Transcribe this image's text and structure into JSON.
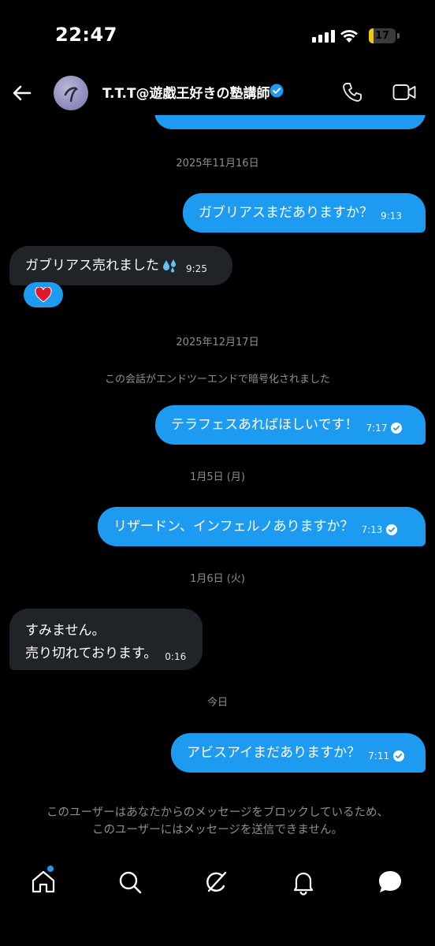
{
  "status_bar": {
    "time": "22:47",
    "battery": "17",
    "battery_level": 0.17
  },
  "header": {
    "contact_name": "T.T.T@遊戯王好きの塾講師",
    "verified": true
  },
  "colors": {
    "accent": "#1d9bf0",
    "incoming_bubble": "#202327",
    "muted_text": "#8b8f94",
    "background": "#000000"
  },
  "conversation": {
    "date_1": "2025年11月16日",
    "msg_1": {
      "text": "ガブリアスまだありますか？",
      "time": "9:13",
      "direction": "outgoing"
    },
    "msg_2": {
      "text": "ガブリアス売れました",
      "emoji_icon": "sweat-droplets-icon",
      "time": "9:25",
      "direction": "incoming",
      "reaction_icon": "red-heart-icon"
    },
    "date_2": "2025年12月17日",
    "system_notice": "この会話がエンドツーエンドで暗号化されました",
    "msg_3": {
      "text": "テラフェスあればほしいです！",
      "time": "7:17",
      "direction": "outgoing",
      "status_icon": "read-check-icon"
    },
    "date_3": "1月5日 (月)",
    "msg_4": {
      "text": "リザードン、インフェルノありますか？",
      "time": "7:13",
      "direction": "outgoing",
      "status_icon": "read-check-icon"
    },
    "date_4": "1月6日 (火)",
    "msg_5": {
      "line_1": "すみません。",
      "line_2": "売り切れております。",
      "time": "0:16",
      "direction": "incoming"
    },
    "date_5": "今日",
    "msg_6": {
      "text": "アビスアイまだありますか？",
      "time": "7:11",
      "direction": "outgoing",
      "status_icon": "read-check-icon"
    }
  },
  "blocked_notice": {
    "line_1": "このユーザーはあなたからのメッセージをブロックしているため、",
    "line_2": "このユーザーにはメッセージを送信できません。"
  },
  "bottom_nav": {
    "items": [
      "home-icon",
      "search-icon",
      "grok-icon",
      "notifications-icon",
      "messages-icon"
    ],
    "home_has_notification_dot": true
  }
}
